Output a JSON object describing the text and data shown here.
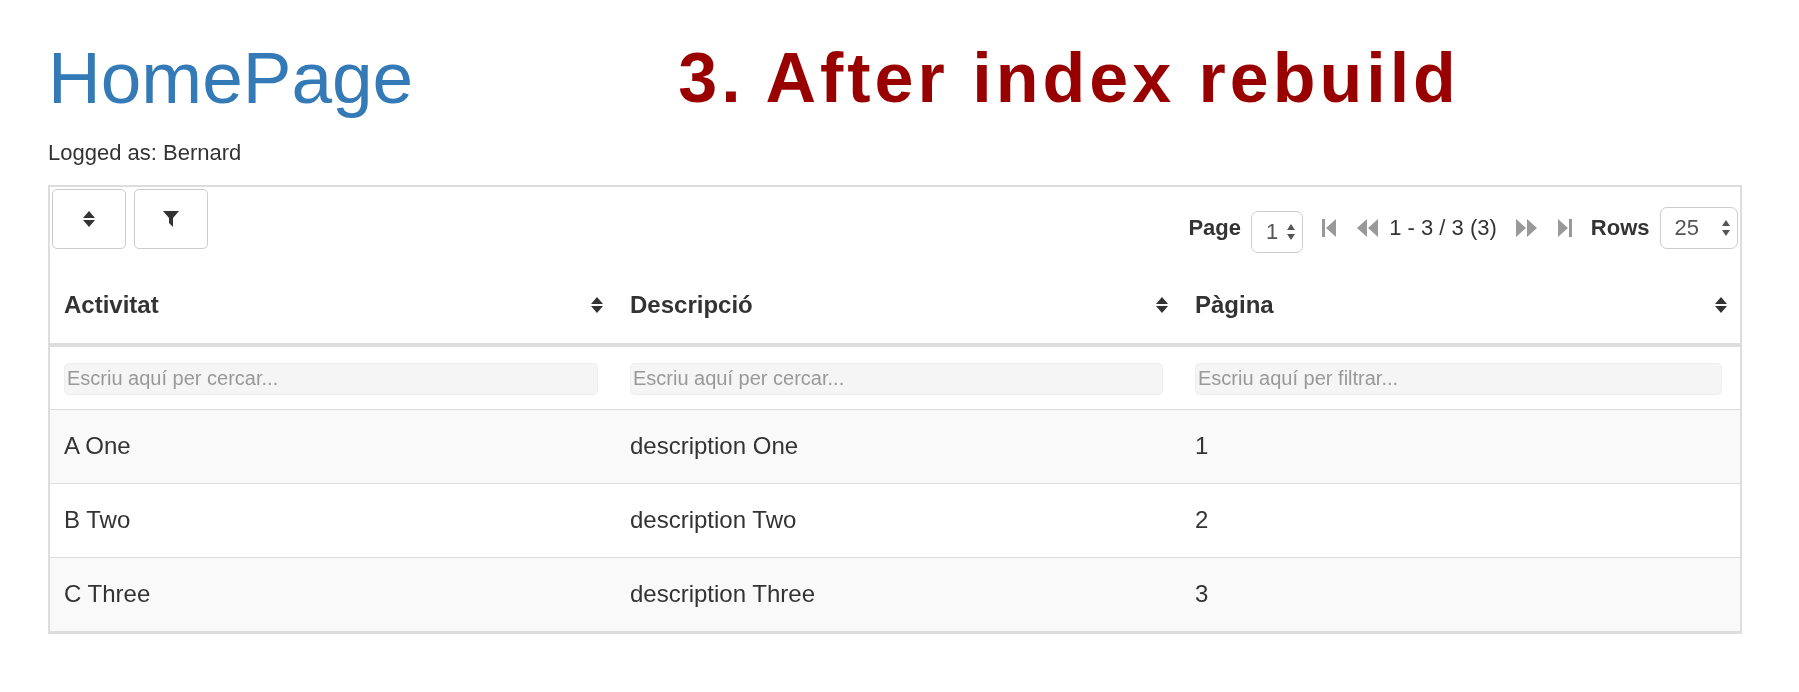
{
  "page_title": "HomePage",
  "annotation": "3. After index rebuild",
  "logged_as": "Logged as: Bernard",
  "toolbar": {
    "page_label": "Page",
    "page_value": "1",
    "range": "1 - 3 / 3 (3)",
    "rows_label": "Rows",
    "rows_value": "25"
  },
  "table": {
    "columns": [
      {
        "label": "Activitat",
        "filter_placeholder": "Escriu aquí per cercar..."
      },
      {
        "label": "Descripció",
        "filter_placeholder": "Escriu aquí per cercar..."
      },
      {
        "label": "Pàgina",
        "filter_placeholder": "Escriu aquí per filtrar..."
      }
    ],
    "rows": [
      [
        "A One",
        "description One",
        "1"
      ],
      [
        "B Two",
        "description Two",
        "2"
      ],
      [
        "C Three",
        "description Three",
        "3"
      ]
    ]
  }
}
